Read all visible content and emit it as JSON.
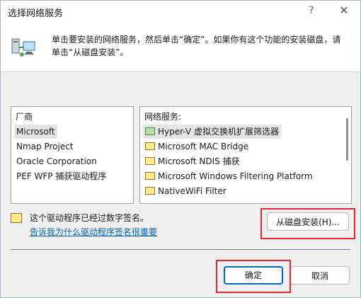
{
  "window": {
    "title": "选择网络服务",
    "help_glyph": "?",
    "close_glyph": "✕"
  },
  "header": {
    "instruction": "单击要安装的网络服务，然后单击“确定”。如果你有这个功能的安装磁盘，请单击“从磁盘安装”。"
  },
  "manufacturers": {
    "header": "厂商",
    "items": [
      "Microsoft",
      "Nmap Project",
      "Oracle Corporation",
      "PEF WFP 捕获驱动程序"
    ],
    "selected_index": 0
  },
  "services": {
    "header": "网络服务:",
    "items": [
      {
        "label": "Hyper-V 虚拟交换机扩展筛选器",
        "icon": "network-service-green-icon"
      },
      {
        "label": "Microsoft MAC Bridge",
        "icon": "network-service-icon"
      },
      {
        "label": "Microsoft NDIS 捕获",
        "icon": "network-service-icon"
      },
      {
        "label": "Microsoft Windows Filtering Platform",
        "icon": "network-service-icon"
      },
      {
        "label": "NativeWiFi Filter",
        "icon": "network-service-icon"
      }
    ],
    "selected_index": 0
  },
  "signature": {
    "status": "这个驱动程序已经过数字签名。",
    "link": "告诉我为什么驱动程序签名很重要"
  },
  "buttons": {
    "have_disk": "从磁盘安装(H)...",
    "ok": "确定",
    "cancel": "取消"
  },
  "colors": {
    "accent": "#0067c0",
    "highlight_box": "#e8262b",
    "dialog_bg": "#f0f0f0"
  }
}
